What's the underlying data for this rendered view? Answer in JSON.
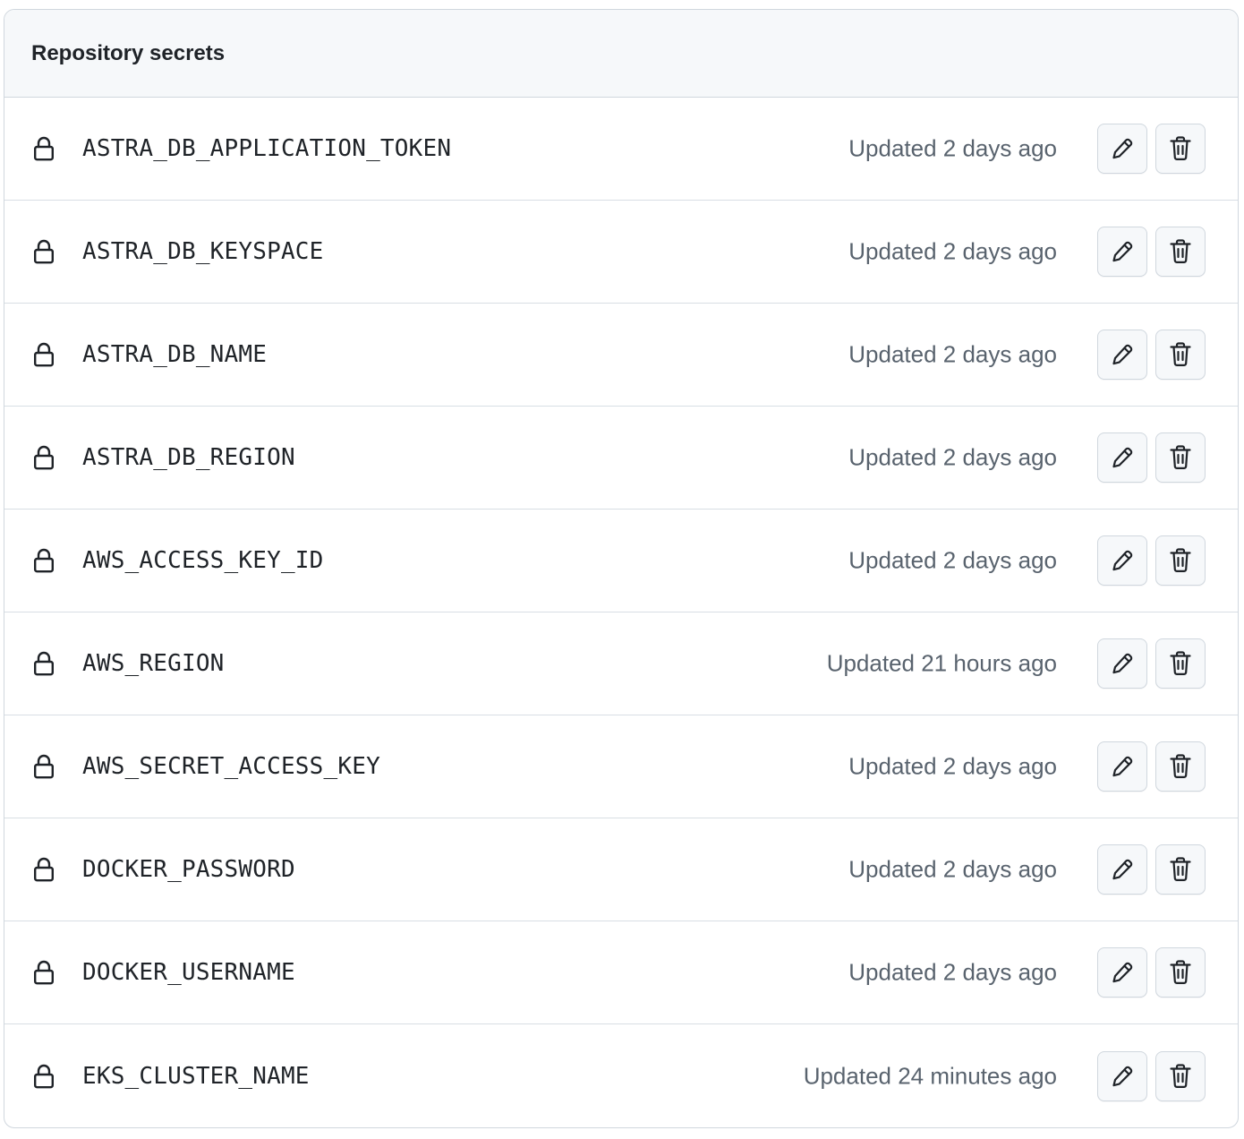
{
  "section": {
    "title": "Repository secrets"
  },
  "secrets": [
    {
      "name": "ASTRA_DB_APPLICATION_TOKEN",
      "updated": "Updated 2 days ago"
    },
    {
      "name": "ASTRA_DB_KEYSPACE",
      "updated": "Updated 2 days ago"
    },
    {
      "name": "ASTRA_DB_NAME",
      "updated": "Updated 2 days ago"
    },
    {
      "name": "ASTRA_DB_REGION",
      "updated": "Updated 2 days ago"
    },
    {
      "name": "AWS_ACCESS_KEY_ID",
      "updated": "Updated 2 days ago"
    },
    {
      "name": "AWS_REGION",
      "updated": "Updated 21 hours ago"
    },
    {
      "name": "AWS_SECRET_ACCESS_KEY",
      "updated": "Updated 2 days ago"
    },
    {
      "name": "DOCKER_PASSWORD",
      "updated": "Updated 2 days ago"
    },
    {
      "name": "DOCKER_USERNAME",
      "updated": "Updated 2 days ago"
    },
    {
      "name": "EKS_CLUSTER_NAME",
      "updated": "Updated 24 minutes ago"
    }
  ],
  "icons": {
    "row": "lock-icon",
    "edit": "pencil-icon",
    "delete": "trash-icon"
  },
  "colors": {
    "border": "#d0d7de",
    "header_bg": "#f6f8fa",
    "muted_text": "#59636e",
    "text": "#1f2328"
  }
}
